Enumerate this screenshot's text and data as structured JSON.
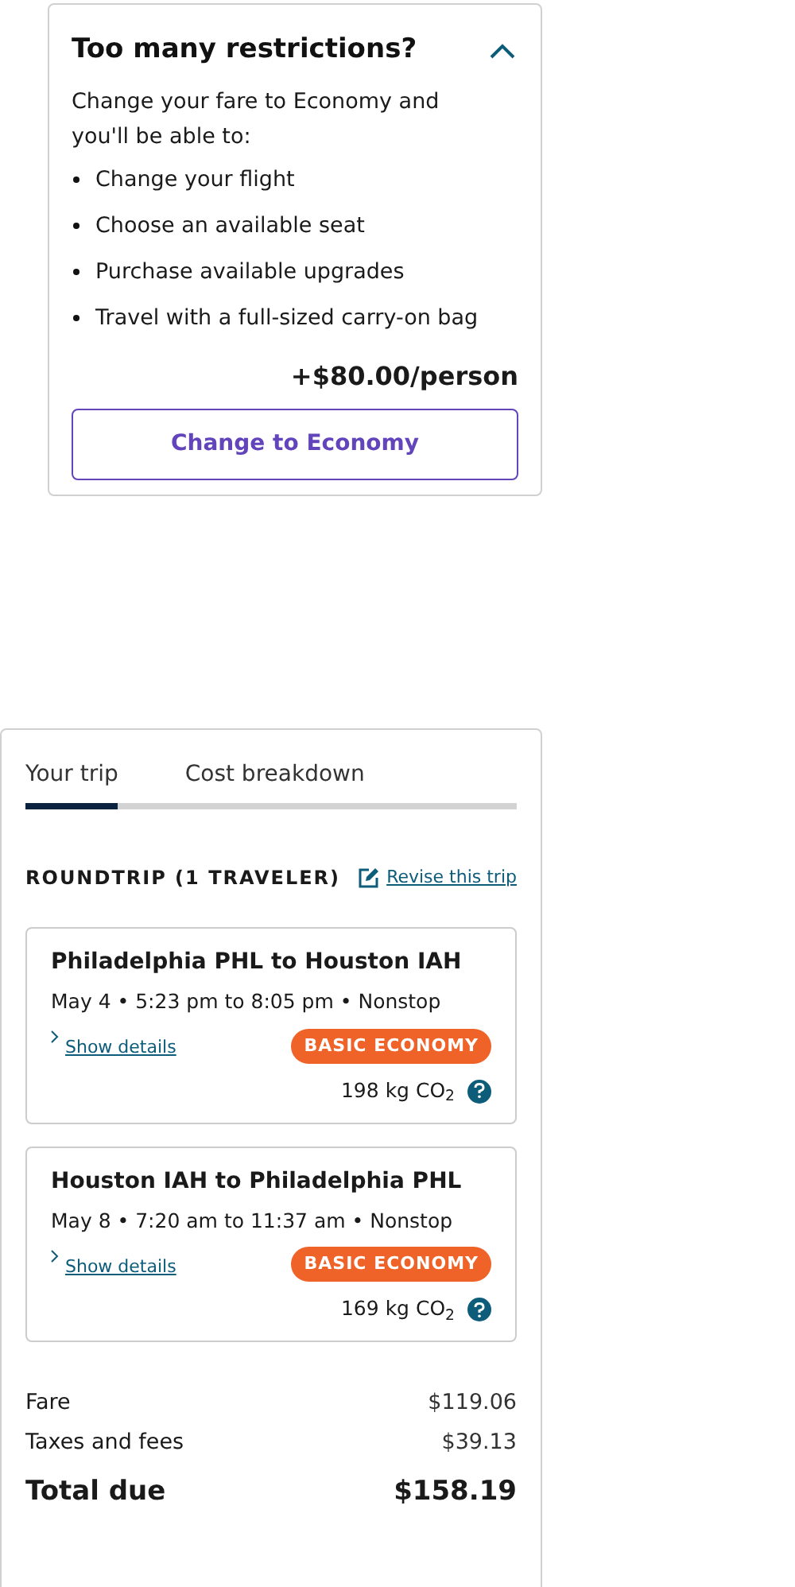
{
  "upsell": {
    "title": "Too many restrictions?",
    "expanded": true,
    "intro": "Change your fare to Economy and you'll be able to:",
    "benefits": [
      "Change your flight",
      "Choose an available seat",
      "Purchase available upgrades",
      "Travel with a full-sized carry-on bag"
    ],
    "price": "+$80.00/person",
    "button": "Change to Economy"
  },
  "trip": {
    "tabs": [
      {
        "label": "Your trip",
        "selected": true
      },
      {
        "label": "Cost breakdown",
        "selected": false
      }
    ],
    "heading": "ROUNDTRIP (1 TRAVELER)",
    "revise_link": "Revise this trip",
    "flights": [
      {
        "route": "Philadelphia PHL to Houston IAH",
        "schedule": "May 4 • 5:23 pm to 8:05 pm • Nonstop",
        "details_link": "Show details",
        "fare_badge": "BASIC ECONOMY",
        "emissions": "198 kg CO$_{2}$"
      },
      {
        "route": "Houston IAH to Philadelphia PHL",
        "schedule": "May 8 • 7:20 am to 11:37 am • Nonstop",
        "details_link": "Show details",
        "fare_badge": "BASIC ECONOMY",
        "emissions": "169 kg CO$_{2}$"
      }
    ],
    "costs": [
      {
        "kind": "line",
        "label": "Fare",
        "amount": "$119.06"
      },
      {
        "kind": "line",
        "label": "Taxes and fees",
        "amount": "$39.13"
      },
      {
        "kind": "total",
        "label": "Total due",
        "amount": "$158.19"
      }
    ]
  }
}
